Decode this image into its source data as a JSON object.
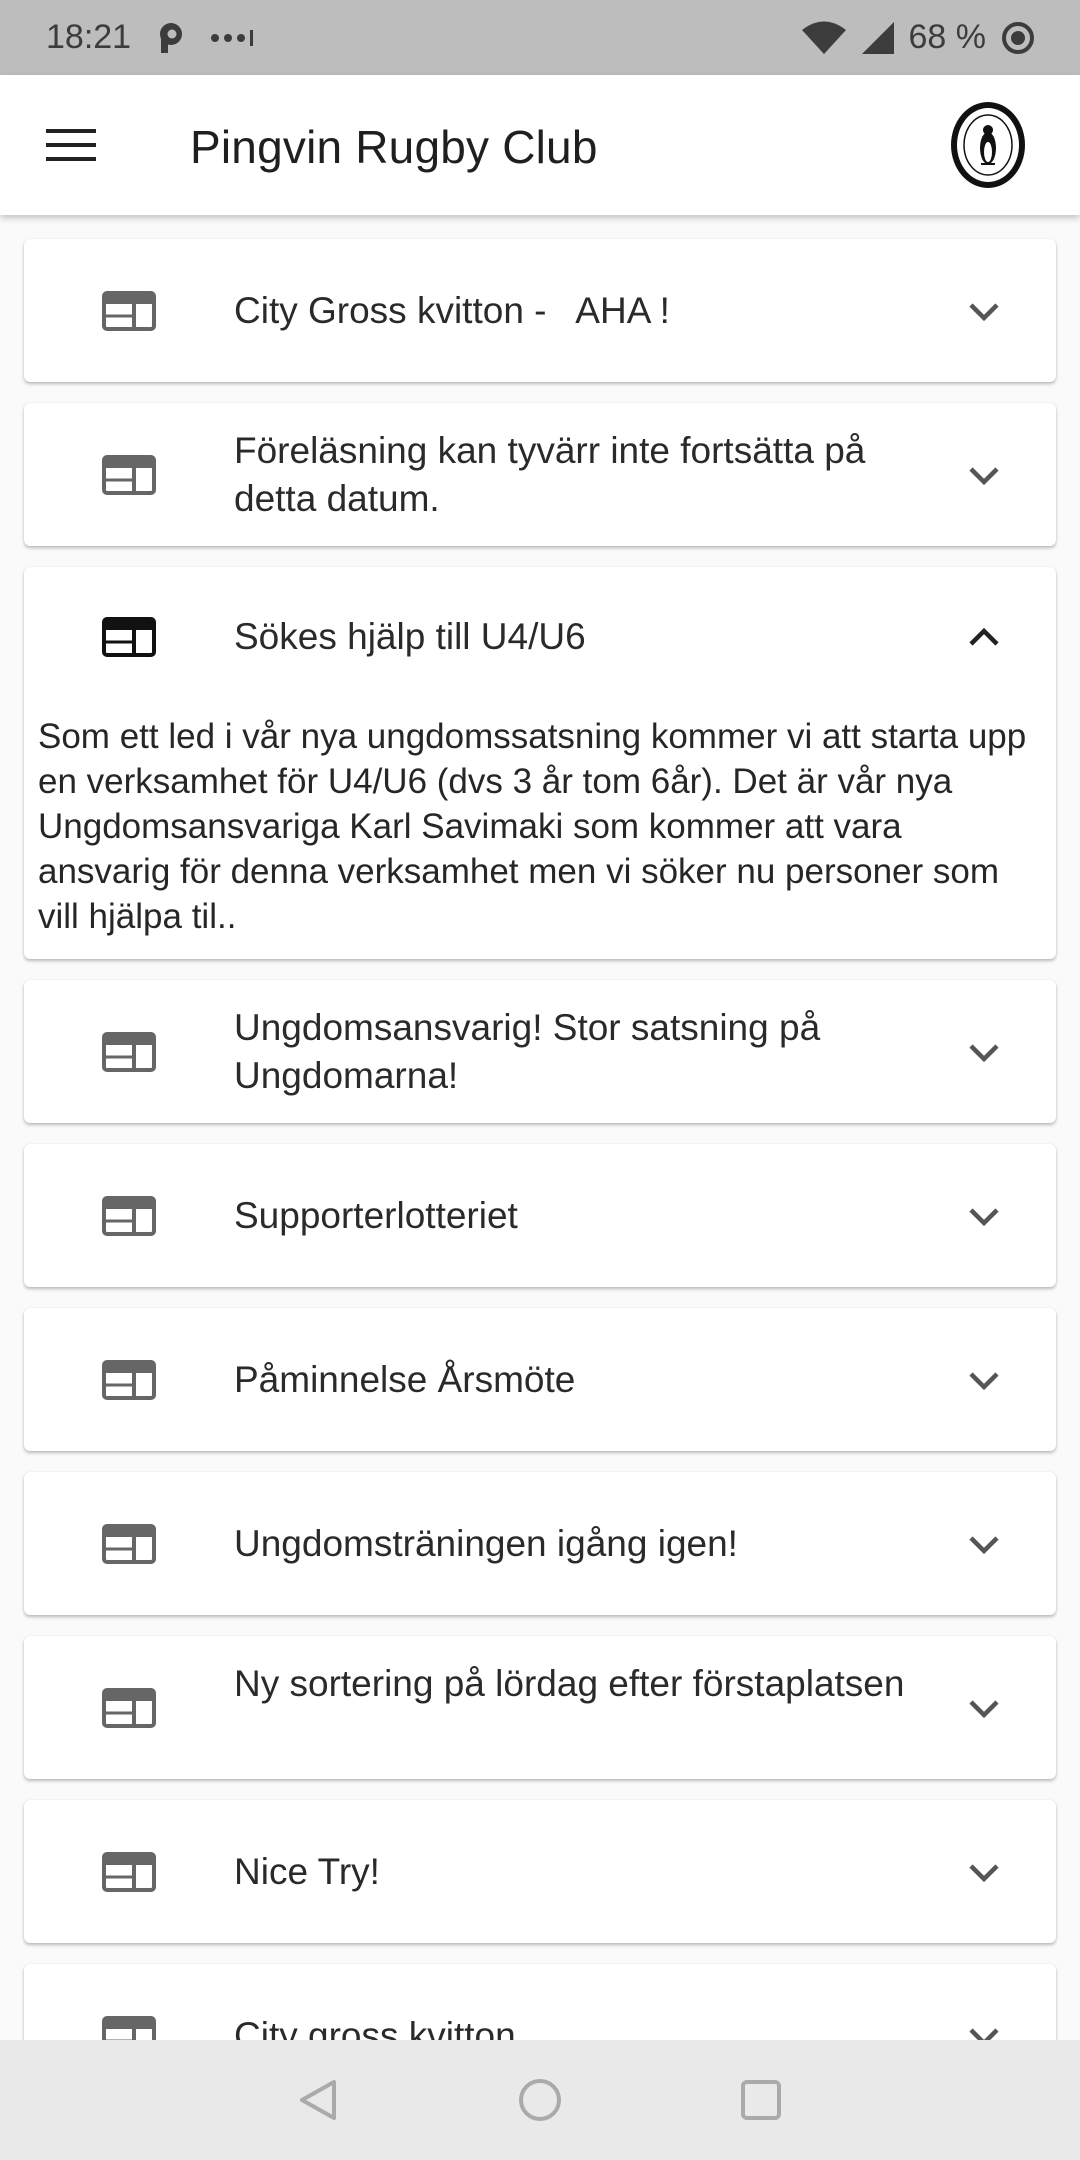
{
  "status_bar": {
    "time": "18:21",
    "battery": "68 %",
    "icons": [
      "p-app-icon",
      "more-dots-icon",
      "wifi-icon",
      "signal-icon",
      "battery-saver-icon"
    ]
  },
  "app_bar": {
    "title": "Pingvin Rugby Club",
    "menu_icon": "hamburger-menu-icon",
    "logo_icon": "club-logo"
  },
  "news": [
    {
      "title": "City Gross kvitton -   AHA !",
      "expanded": false
    },
    {
      "title": "Föreläsning kan tyvärr inte fortsätta på detta datum.",
      "expanded": false
    },
    {
      "title": "Sökes hjälp till U4/U6",
      "expanded": true,
      "body": " Som ett led i vår nya ungdomssatsning kommer vi att starta upp en verksamhet för U4/U6 (dvs 3 år tom 6år). Det är vår nya Ungdomsansvariga Karl Savimaki som kommer att vara ansvarig för denna verksamhet men vi söker nu personer som vill hjälpa til.."
    },
    {
      "title": "Ungdomsansvarig! Stor satsning på Ungdomarna!",
      "expanded": false
    },
    {
      "title": "Supporterlotteriet",
      "expanded": false
    },
    {
      "title": "Påminnelse Årsmöte",
      "expanded": false
    },
    {
      "title": "Ungdomsträningen igång igen!",
      "expanded": false
    },
    {
      "title": "Ny sortering på lördag efter förstaplatsen",
      "expanded": false
    },
    {
      "title": "Nice Try!",
      "expanded": false
    },
    {
      "title": "City gross kvitton",
      "expanded": false
    }
  ],
  "nav_bar": {
    "icons": [
      "back-triangle-icon",
      "home-circle-icon",
      "recents-square-icon"
    ]
  },
  "colors": {
    "status_bar_bg": "#bdbdbd",
    "app_bar_bg": "#ffffff",
    "page_bg": "#fafafa",
    "nav_bar_bg": "#e9e9e9"
  }
}
